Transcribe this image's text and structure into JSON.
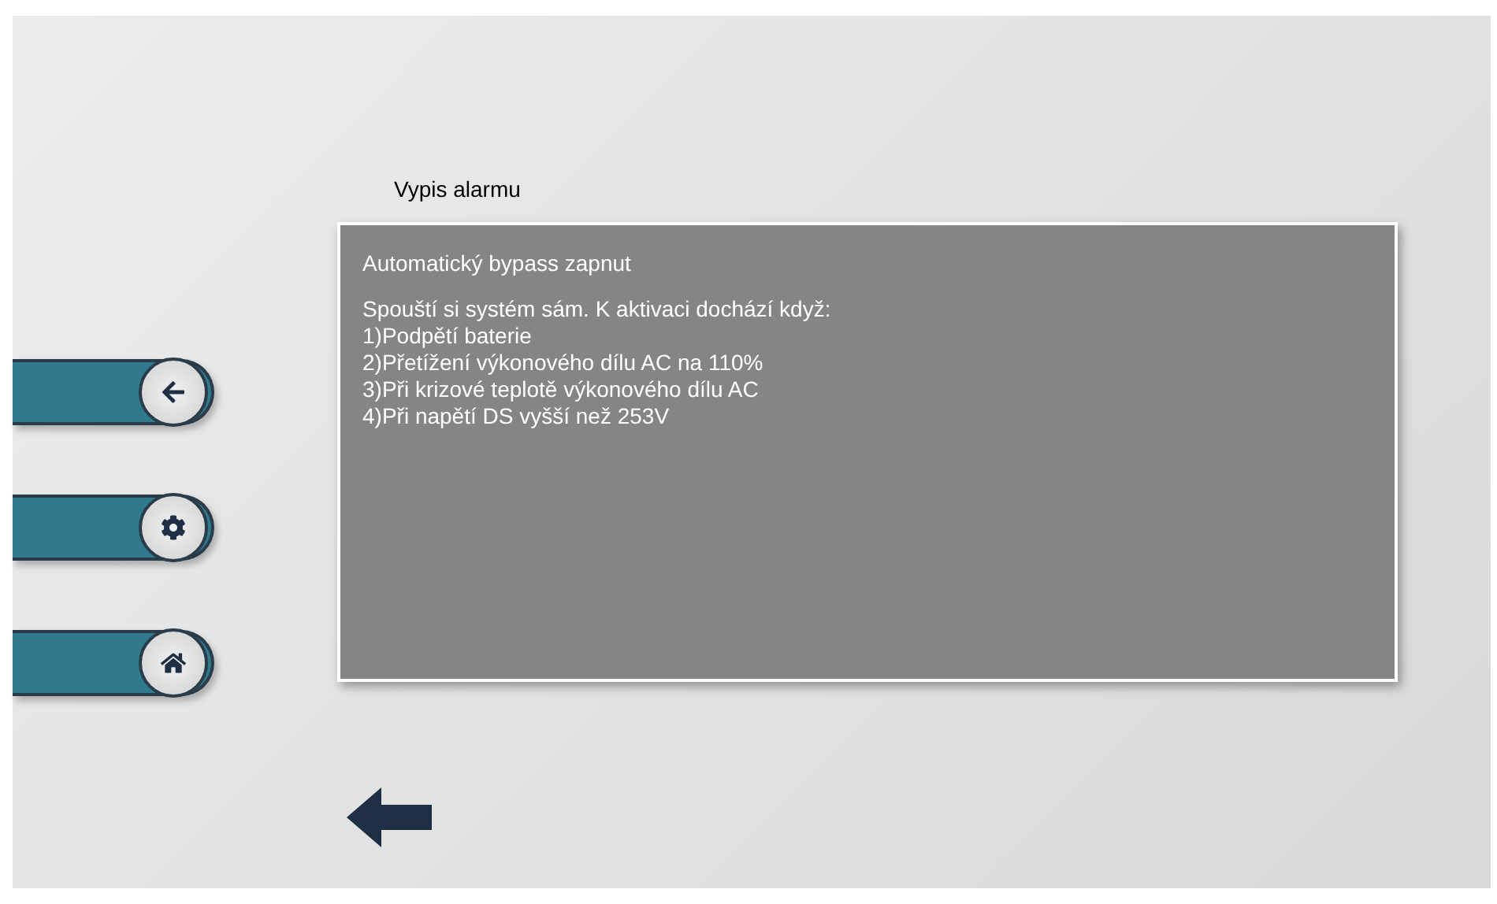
{
  "title": "Vypis alarmu",
  "panel": {
    "heading": "Automatický bypass zapnut",
    "lines": [
      "Spouští si systém sám. K aktivaci dochází když:",
      "1)Podpětí baterie",
      "2)Přetížení výkonového dílu AC na 110%",
      "3)Při krizové teplotě výkonového dílu AC",
      "4)Při napětí DS vyšší než 253V"
    ]
  },
  "side_buttons": [
    {
      "kind": "back"
    },
    {
      "kind": "settings"
    },
    {
      "kind": "home"
    }
  ]
}
